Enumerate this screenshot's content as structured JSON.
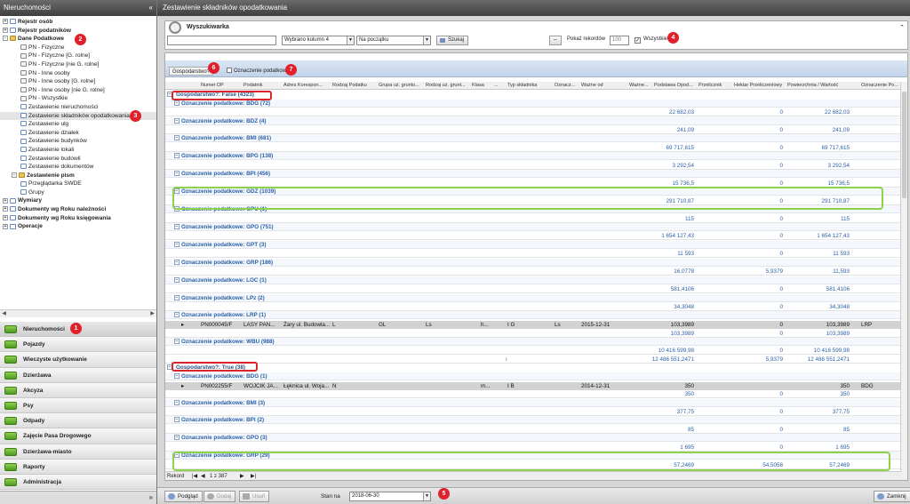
{
  "left": {
    "title": "Nieruchomości",
    "tree": [
      {
        "label": "Rejestr osób",
        "bold": true,
        "level": 0,
        "exp": "+",
        "icon": "page"
      },
      {
        "label": "Rejestr podatników",
        "bold": true,
        "level": 0,
        "exp": "+",
        "icon": "page"
      },
      {
        "label": "Dane Podatkowe",
        "bold": true,
        "level": 0,
        "exp": "-",
        "icon": "folder"
      },
      {
        "label": "PN - Fizyczne",
        "level": 2,
        "icon": "doc"
      },
      {
        "label": "PN - Fizyczne [G. rolne]",
        "level": 2,
        "icon": "doc"
      },
      {
        "label": "PN - Fizyczne [nie G. rolne]",
        "level": 2,
        "icon": "doc"
      },
      {
        "label": "PN - Inne osoby",
        "level": 2,
        "icon": "doc"
      },
      {
        "label": "PN - Inne osoby [G. rolne]",
        "level": 2,
        "icon": "doc"
      },
      {
        "label": "PN - Inne osoby [nie G. rolne]",
        "level": 2,
        "icon": "doc"
      },
      {
        "label": "PN - Wszystkie",
        "level": 2,
        "icon": "doc"
      },
      {
        "label": "Zestawienie nieruchomości",
        "level": 2,
        "icon": "page"
      },
      {
        "label": "Zestawienie składników opodatkowania",
        "level": 2,
        "icon": "page",
        "selected": true
      },
      {
        "label": "Zestawienie ulg",
        "level": 2,
        "icon": "page"
      },
      {
        "label": "Zestawienie działek",
        "level": 2,
        "icon": "page"
      },
      {
        "label": "Zestawienie budynków",
        "level": 2,
        "icon": "page"
      },
      {
        "label": "Zestawienie lokali",
        "level": 2,
        "icon": "page"
      },
      {
        "label": "Zestawienie budowli",
        "level": 2,
        "icon": "page"
      },
      {
        "label": "Zestawienie dokumentów",
        "level": 2,
        "icon": "page"
      },
      {
        "label": "Zestawienie pism",
        "bold": true,
        "level": 1,
        "exp": "-",
        "icon": "folder"
      },
      {
        "label": "Przeglądarka SWDE",
        "level": 2,
        "icon": "page"
      },
      {
        "label": "Grupy",
        "level": 2,
        "icon": "page"
      },
      {
        "label": "Wymiary",
        "bold": true,
        "level": 0,
        "exp": "+",
        "icon": "page"
      },
      {
        "label": "Dokumenty wg Roku należności",
        "bold": true,
        "level": 0,
        "exp": "+",
        "icon": "page"
      },
      {
        "label": "Dokumenty wg Roku księgowania",
        "bold": true,
        "level": 0,
        "exp": "+",
        "icon": "page"
      },
      {
        "label": "Operacje",
        "bold": true,
        "level": 0,
        "exp": "+",
        "icon": "page"
      }
    ],
    "nav": [
      "Nieruchomości",
      "Pojazdy",
      "Wieczyste użytkowanie",
      "Dzierżawa",
      "Akcyza",
      "Psy",
      "Odpady",
      "Zajęcie Pasa Drogowego",
      "Dzierżawa-miasto",
      "Raporty",
      "Administracja"
    ]
  },
  "main": {
    "title": "Zestawienie składników opodatkowania",
    "search": {
      "title": "Wyszukiwarka",
      "column": "Wybrano kolumn 4",
      "mode": "Na początku",
      "search_btn": "Szukaj",
      "show_label": "Pokaż rekordów",
      "show_value": "100",
      "all_label": "Wszystkie"
    },
    "groupbar": {
      "g1": "Gospodarstwo?",
      "g2": "Oznaczenie podatkowe"
    },
    "columns": [
      "Numer DP",
      "Podatnik",
      "Adres Korespon...",
      "Rodzaj Podatku",
      "Grupa uż. grunto...",
      "Rodzaj uż. grunt...",
      "Klasa",
      "...",
      "Typ składnika",
      "Oznacz...",
      "Ważne od",
      "Ważne...",
      "Podstawa Opod...",
      "Przelicznik",
      "Hektar Przeliczeniowy",
      "Powierzchnia / Wartość",
      "Oznaczenie Po..."
    ],
    "rows": [
      {
        "t": "g1",
        "text": "Gospodarstwo?: False (4323)"
      },
      {
        "t": "g2",
        "text": "Oznaczenie podatkowe: BDG (72)"
      },
      {
        "t": "sum",
        "a": "22 682,03",
        "b": "0",
        "c": "22 682,03"
      },
      {
        "t": "g2",
        "text": "Oznaczenie podatkowe: BDZ (4)"
      },
      {
        "t": "sum",
        "a": "241,09",
        "b": "0",
        "c": "241,09"
      },
      {
        "t": "g2",
        "text": "Oznaczenie podatkowe: BMI (681)"
      },
      {
        "t": "sum",
        "a": "69 717,615",
        "b": "0",
        "c": "69 717,615"
      },
      {
        "t": "g2",
        "text": "Oznaczenie podatkowe: BPG (138)"
      },
      {
        "t": "sum",
        "a": "3 292,54",
        "b": "0",
        "c": "3 292,54"
      },
      {
        "t": "g2",
        "text": "Oznaczenie podatkowe: BPI (456)"
      },
      {
        "t": "sum",
        "a": "15 736,5",
        "b": "0",
        "c": "15 736,5"
      },
      {
        "t": "g2",
        "text": "Oznaczenie podatkowe: GDZ (1039)"
      },
      {
        "t": "sum",
        "a": "291 710,87",
        "b": "0",
        "c": "291 710,87"
      },
      {
        "t": "g2",
        "text": "Oznaczenie podatkowe: GPU (1)"
      },
      {
        "t": "sum",
        "a": "115",
        "b": "0",
        "c": "115"
      },
      {
        "t": "g2",
        "text": "Oznaczenie podatkowe: GPO (751)"
      },
      {
        "t": "sum",
        "a": "1 654 127,43",
        "b": "0",
        "c": "1 654 127,43"
      },
      {
        "t": "g2",
        "text": "Oznaczenie podatkowe: GPT (3)"
      },
      {
        "t": "sum",
        "a": "11 593",
        "b": "0",
        "c": "11 593"
      },
      {
        "t": "g2",
        "text": "Oznaczenie podatkowe: GRP (186)"
      },
      {
        "t": "sum",
        "a": "16,0778",
        "b": "5,9379",
        "c": "11,593"
      },
      {
        "t": "g2",
        "text": "Oznaczenie podatkowe: LOC (1)"
      },
      {
        "t": "sum",
        "a": "581,4106",
        "b": "0",
        "c": "581,4106"
      },
      {
        "t": "g2",
        "text": "Oznaczenie podatkowe: LPz (2)"
      },
      {
        "t": "sum",
        "a": "34,3048",
        "b": "0",
        "c": "34,3048"
      },
      {
        "t": "g2",
        "text": "Oznaczenie podatkowe: LRP (1)"
      },
      {
        "t": "d",
        "nr": "PN000045/F",
        "pod": "LASY PAN...",
        "adr": "Żary ul. Budowla...",
        "rp": "L",
        "gr": "GL",
        "ru": "Ls",
        "kl": "h...",
        "ty": "I G",
        "oz": "Ls",
        "od": "2015-12-31",
        "a": "103,3989",
        "b": "0",
        "c": "103,3989",
        "op": "LRP"
      },
      {
        "t": "sum",
        "a": "103,3989",
        "b": "0",
        "c": "103,3989"
      },
      {
        "t": "g2",
        "text": "Oznaczenie podatkowe: WBU (988)"
      },
      {
        "t": "sum",
        "a": "10 416 599,98",
        "b": "0",
        "c": "10 416 599,98"
      },
      {
        "t": "sum2",
        "a": "12 486 551,2471",
        "b": "5,9379",
        "c": "12 486 551,2471"
      },
      {
        "t": "g1",
        "text": "Gospodarstwo?: True (38)"
      },
      {
        "t": "g2",
        "text": "Oznaczenie podatkowe: BDG (1)"
      },
      {
        "t": "d",
        "nr": "PN002255/F",
        "pod": "WOJCIK JA...",
        "adr": "Łęknica ul. Woja...",
        "rp": "N",
        "gr": "",
        "ru": "",
        "kl": "m...",
        "ty": "I B",
        "oz": "",
        "od": "2014-12-31",
        "a": "350",
        "b": "",
        "c": "350",
        "op": "BDG"
      },
      {
        "t": "sum",
        "a": "350",
        "b": "0",
        "c": "350"
      },
      {
        "t": "g2",
        "text": "Oznaczenie podatkowe: BMI (3)"
      },
      {
        "t": "sum",
        "a": "377,75",
        "b": "0",
        "c": "377,75"
      },
      {
        "t": "g2",
        "text": "Oznaczenie podatkowe: BPI (2)"
      },
      {
        "t": "sum",
        "a": "85",
        "b": "0",
        "c": "85"
      },
      {
        "t": "g2",
        "text": "Oznaczenie podatkowe: GPO (3)"
      },
      {
        "t": "sum",
        "a": "1 695",
        "b": "0",
        "c": "1 695"
      },
      {
        "t": "g2",
        "text": "Oznaczenie podatkowe: GRP (29)"
      },
      {
        "t": "sum",
        "a": "57,2469",
        "b": "54,5058",
        "c": "57,2469"
      }
    ],
    "pager": {
      "label": "Rekord",
      "page": "1 z 387"
    },
    "bottom": {
      "preview": "Podgląd",
      "add": "Dodaj",
      "remove": "Usuń",
      "stan_label": "Stan na",
      "stan_value": "2018-06-30",
      "close": "Zamknij"
    }
  },
  "badges": [
    "1",
    "2",
    "3",
    "4",
    "5",
    "6",
    "7"
  ],
  "colors": {
    "header": "#4a4a4a",
    "group_text": "#2a5fa8",
    "red_annotation": "#d9262b",
    "green_annotation": "#8ed14a",
    "nav_icon": "#5aa829"
  }
}
